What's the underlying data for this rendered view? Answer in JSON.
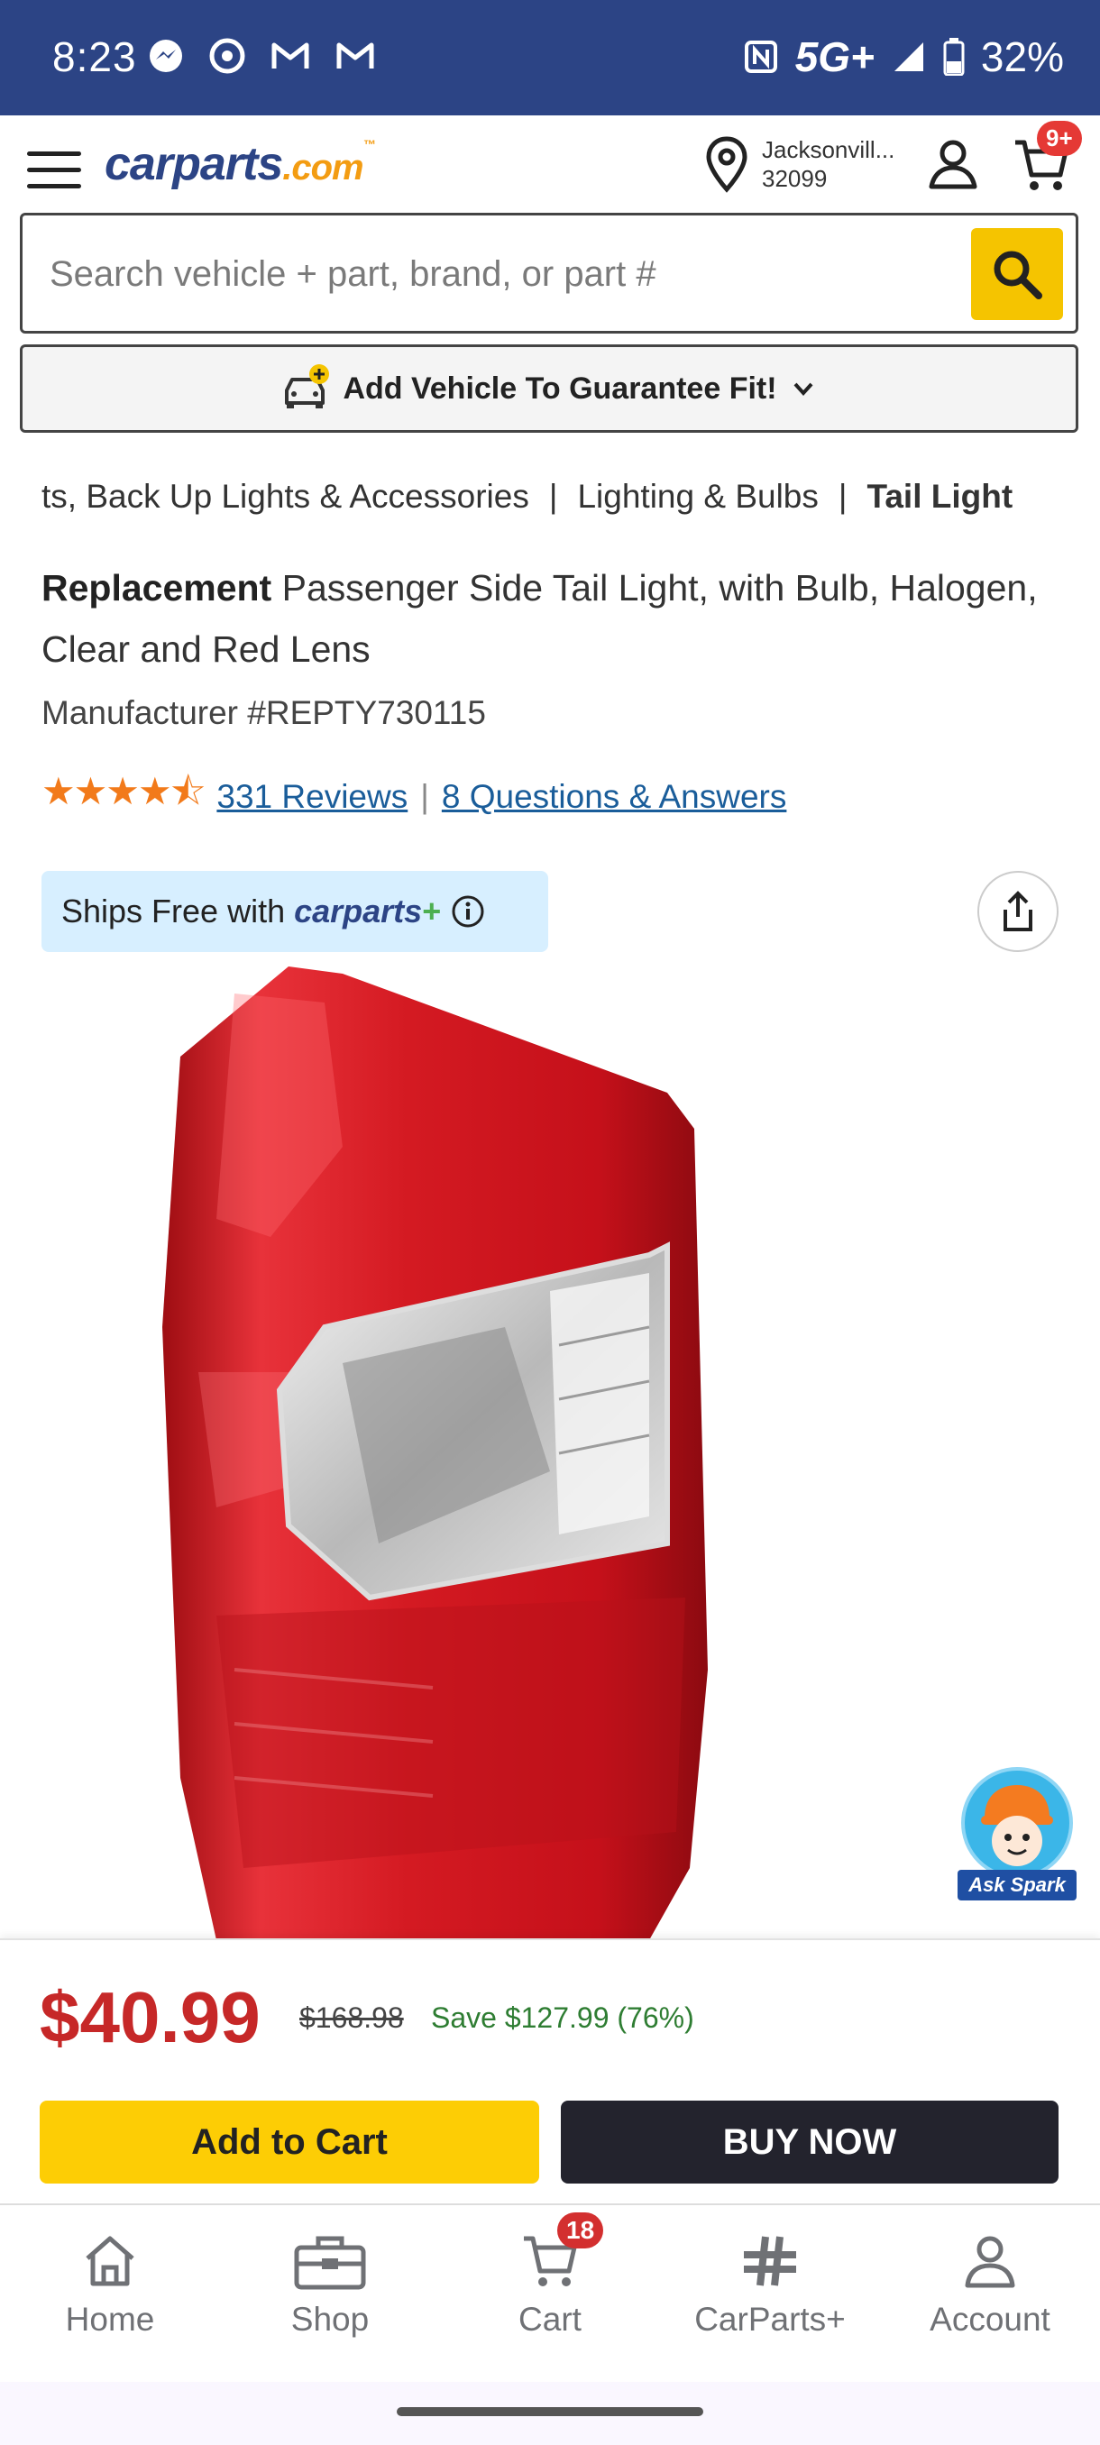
{
  "status_bar": {
    "time": "8:23",
    "network": "5G+",
    "battery": "32%",
    "icons": [
      "messenger-icon",
      "chrome-icon",
      "gmail-icon",
      "gmail-icon",
      "nfc-icon",
      "signal-icon",
      "battery-icon"
    ]
  },
  "header": {
    "logo_main": "carparts",
    "logo_suffix": ".com",
    "location_city": "Jacksonvill...",
    "location_zip": "32099",
    "cart_badge": "9+"
  },
  "search": {
    "placeholder": "Search vehicle + part, brand, or part #"
  },
  "vehicle_bar": {
    "label": "Add Vehicle To Guarantee Fit!"
  },
  "breadcrumb": {
    "items": [
      "ts, Back Up Lights & Accessories",
      "Lighting & Bulbs",
      "Tail Light"
    ],
    "separator": "|"
  },
  "product": {
    "brand": "Replacement",
    "title": "Passenger Side Tail Light, with Bulb, Halogen, Clear and Red Lens",
    "manufacturer": "Manufacturer #REPTY730115",
    "rating": 4.5,
    "stars": "★★★★⯪",
    "reviews_link": "331 Reviews",
    "qa_link": "8 Questions & Answers",
    "ships_free_prefix": "Ships Free with",
    "ships_free_brand": "carparts",
    "ships_free_plus": "+"
  },
  "spark": {
    "label": "Ask Spark"
  },
  "pricing": {
    "price": "$40.99",
    "old_price": "$168.98",
    "save": "Save $127.99 (76%)",
    "add_to_cart": "Add to Cart",
    "buy_now": "BUY NOW"
  },
  "bottom_nav": {
    "home": "Home",
    "shop": "Shop",
    "cart": "Cart",
    "cart_badge": "18",
    "carparts_plus": "CarParts+",
    "account": "Account"
  },
  "colors": {
    "status_bar": "#2c4485",
    "brand_blue": "#2c4485",
    "accent_yellow": "#fdcd05",
    "price_red": "#c62828",
    "save_green": "#2e7d32",
    "link_blue": "#1a5d9a",
    "star_orange": "#f27a1a"
  }
}
